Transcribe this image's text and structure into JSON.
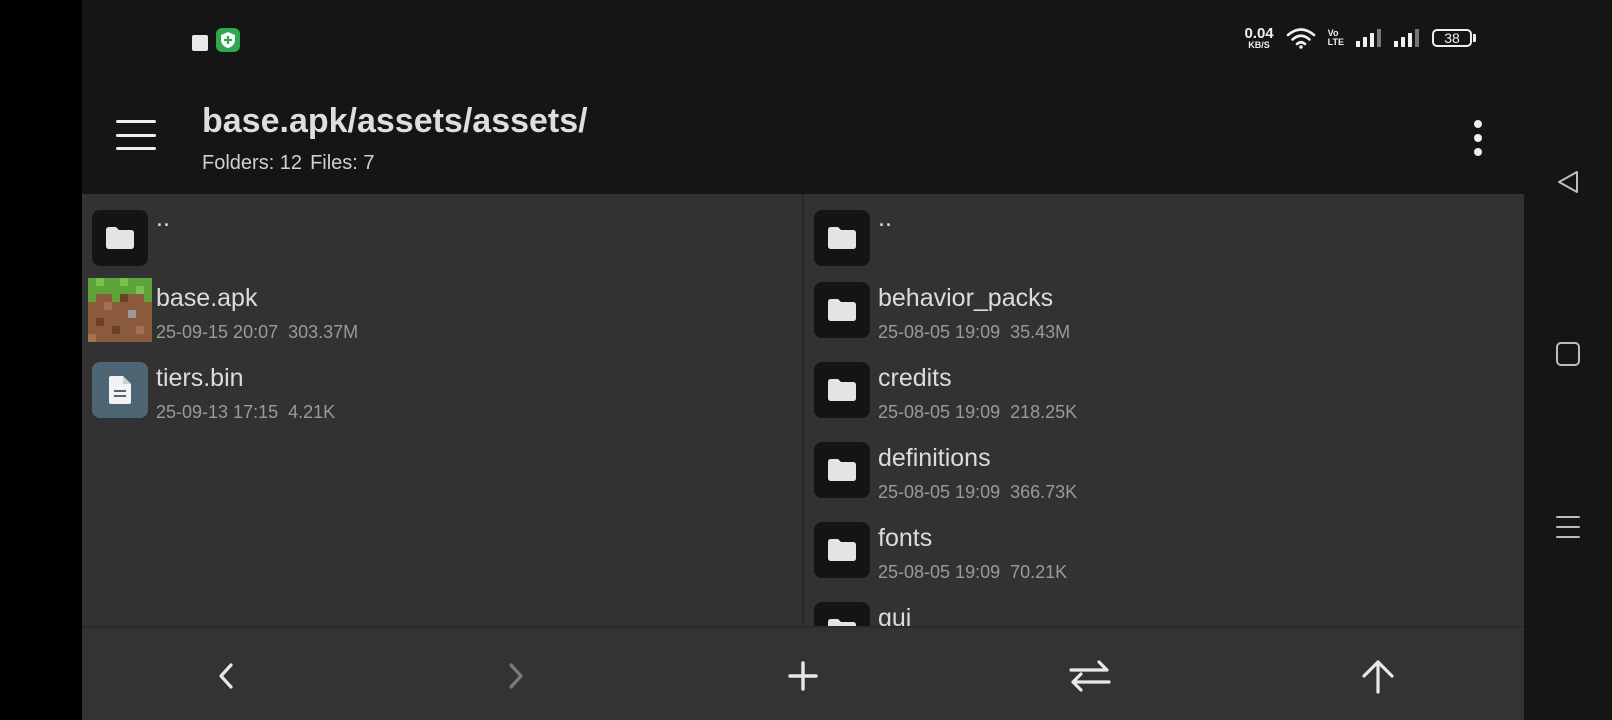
{
  "status_bar": {
    "net_speed": "0.04",
    "net_unit": "KB/S",
    "volte_top": "Vo",
    "volte_bottom": "LTE",
    "battery": "38"
  },
  "header": {
    "path": "base.apk/assets/assets/",
    "folders_count": "Folders: 12",
    "files_count": "Files: 7"
  },
  "left_pane": {
    "items": [
      {
        "name": "..",
        "type": "parent"
      },
      {
        "name": "base.apk",
        "date": "25-09-15 20:07",
        "size": "303.37M",
        "type": "apk"
      },
      {
        "name": "tiers.bin",
        "date": "25-09-13 17:15",
        "size": "4.21K",
        "type": "file"
      }
    ]
  },
  "right_pane": {
    "items": [
      {
        "name": "..",
        "type": "parent"
      },
      {
        "name": "behavior_packs",
        "date": "25-08-05 19:09",
        "size": "35.43M",
        "type": "folder"
      },
      {
        "name": "credits",
        "date": "25-08-05 19:09",
        "size": "218.25K",
        "type": "folder"
      },
      {
        "name": "definitions",
        "date": "25-08-05 19:09",
        "size": "366.73K",
        "type": "folder"
      },
      {
        "name": "fonts",
        "date": "25-08-05 19:09",
        "size": "70.21K",
        "type": "folder"
      },
      {
        "name": "gui",
        "type": "folder"
      }
    ]
  },
  "bottom_bar": {
    "icons": [
      "back-arrow-icon",
      "forward-arrow-icon",
      "add-icon",
      "swap-icon",
      "up-arrow-icon"
    ]
  },
  "colors": {
    "background": "#151515",
    "pane": "#323232",
    "folder_tile": "#141414",
    "file_tile": "#4e6573",
    "text": "#dcdcdc",
    "meta_text": "#9a9a9a",
    "shield_green": "#2fa84f"
  }
}
